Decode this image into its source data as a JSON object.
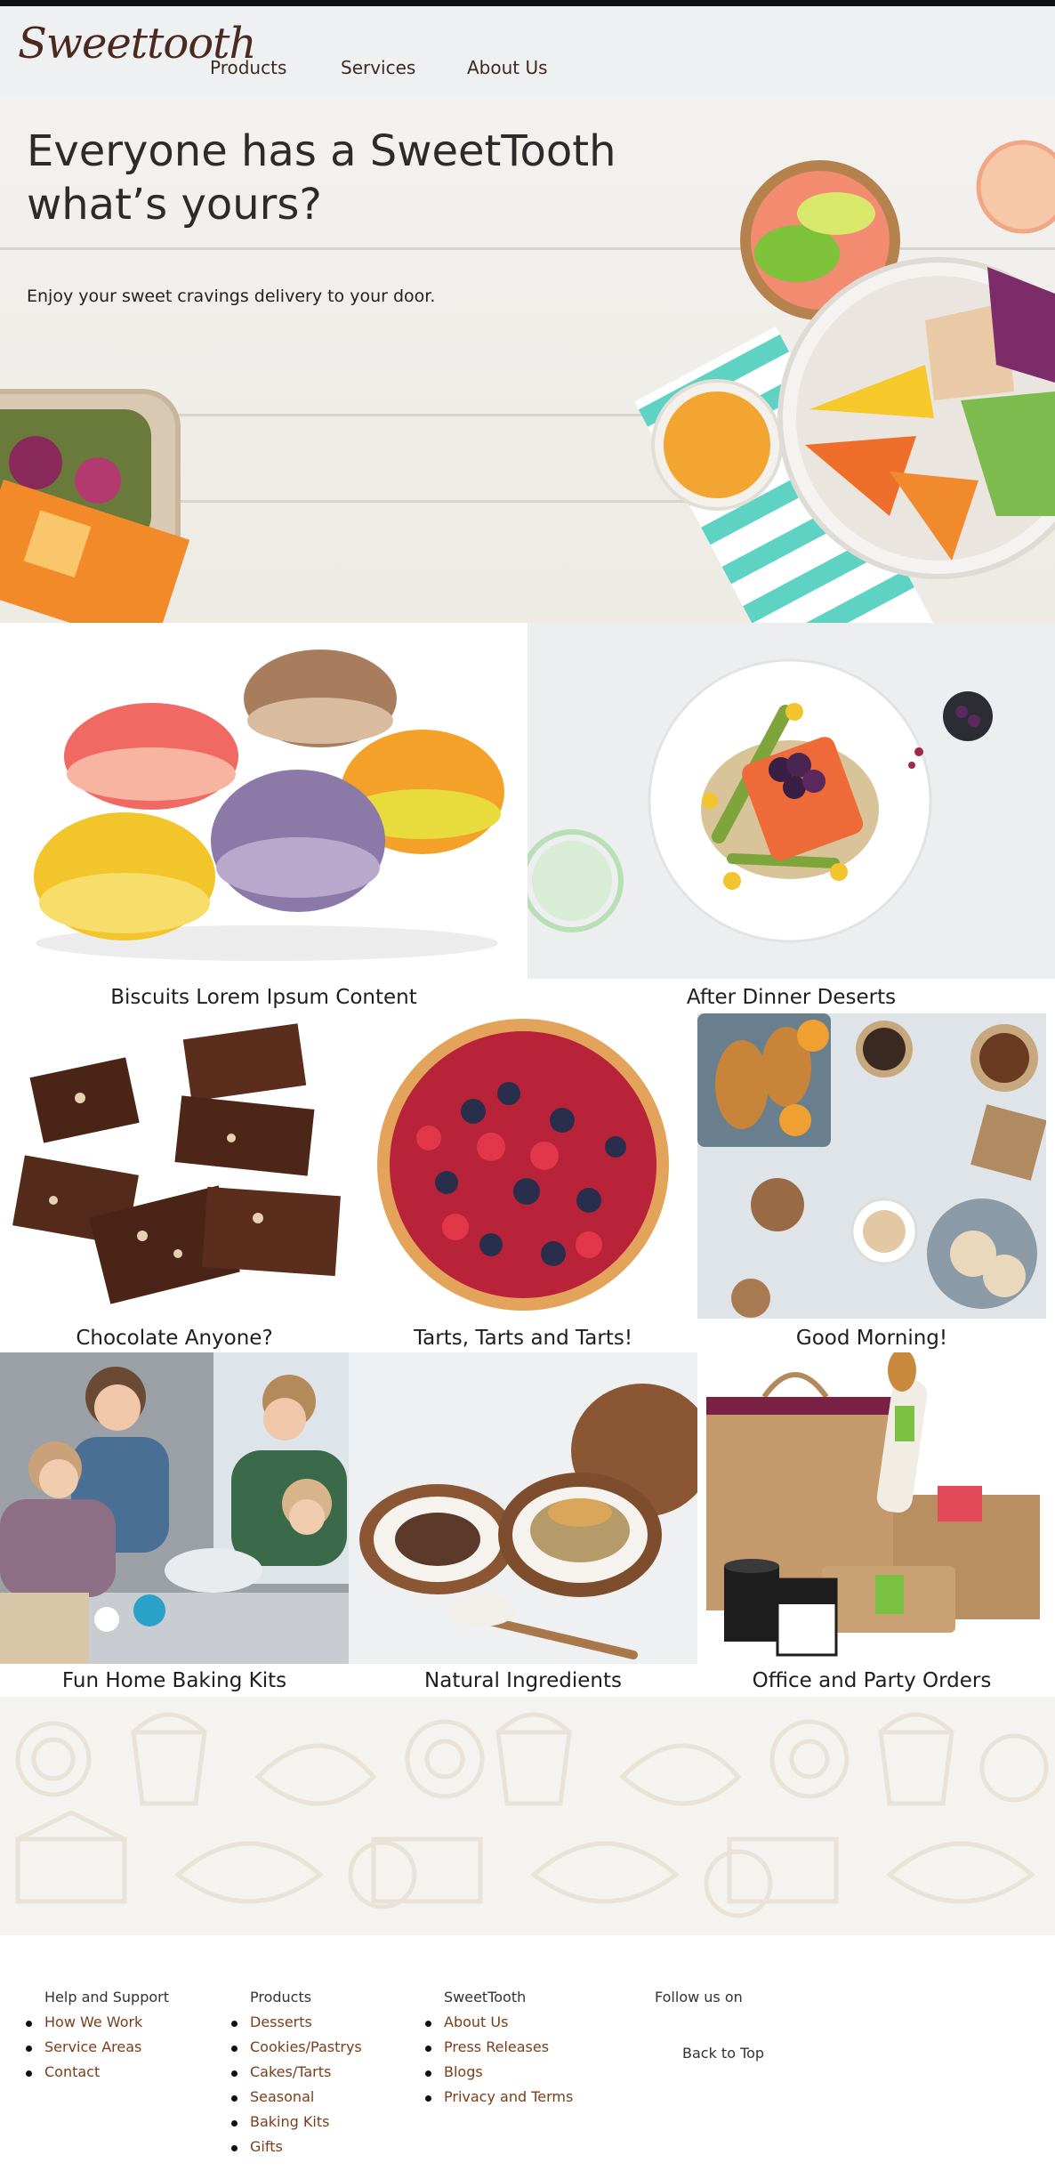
{
  "header": {
    "logo": "Sweettooth",
    "nav": [
      "Products",
      "Services",
      "About Us"
    ]
  },
  "hero": {
    "title": "Everyone has a SweetTooth what’s yours?",
    "subtitle": "Enjoy your sweet cravings delivery to your door."
  },
  "sections": {
    "row1": [
      "Biscuits Lorem Ipsum Content",
      "After Dinner Deserts"
    ],
    "row2": [
      "Chocolate Anyone?",
      "Tarts, Tarts and Tarts!",
      "Good Morning!"
    ],
    "row3": [
      "Fun Home Baking Kits",
      "Natural Ingredients",
      "Office and Party Orders"
    ]
  },
  "footer": {
    "help": {
      "heading": "Help and Support",
      "links": [
        "How We Work",
        "Service Areas",
        "Contact"
      ]
    },
    "products": {
      "heading": "Products",
      "links": [
        "Desserts",
        "Cookies/Pastrys",
        "Cakes/Tarts",
        "Seasonal",
        "Baking Kits",
        "Gifts"
      ]
    },
    "company": {
      "heading": "SweetTooth",
      "links": [
        "About Us",
        "Press Releases",
        "Blogs",
        "Privacy and Terms"
      ]
    },
    "social": {
      "heading": "Follow us on"
    },
    "back_to_top": "Back to Top"
  },
  "colors": {
    "header_bg": "#eef0f1",
    "brand_brown": "#4a2a1e",
    "link_brown": "#7a3e1a",
    "pattern_bg": "#f5f3ef"
  }
}
